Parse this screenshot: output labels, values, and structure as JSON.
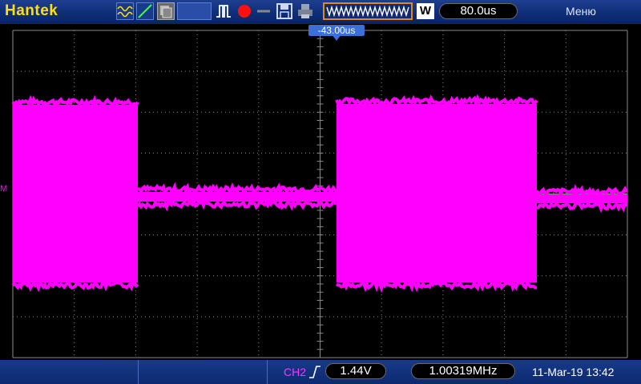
{
  "brand": "Hantek",
  "toolbar": {
    "icons": [
      "acquire-mode-icon",
      "trigger-slope-icon",
      "persistence-icon",
      "blank-box",
      "single-pulse-icon",
      "record-icon",
      "dash-icon",
      "save-icon",
      "print-icon"
    ],
    "window_label": "W",
    "timebase": "80.0us",
    "menu_label": "Меню"
  },
  "screen": {
    "trigger_position": "-43.00us",
    "channel_marker": "M",
    "trace_color": "#ff00ff",
    "grid_color": "#8a8a8a",
    "divisions": {
      "x": 10,
      "y": 8
    }
  },
  "status": {
    "channel": "CH2",
    "trigger_slope": "rising",
    "trigger_level": "1.44V",
    "frequency": "1.00319MHz",
    "datetime": "11-Mar-19 13:42"
  },
  "colors": {
    "brand": "#ffe000",
    "topbar": "#0f2e78",
    "channel": "#ff00ff",
    "timebase_border": "#e08a20",
    "trigger_label": "#3c6fd8"
  }
}
